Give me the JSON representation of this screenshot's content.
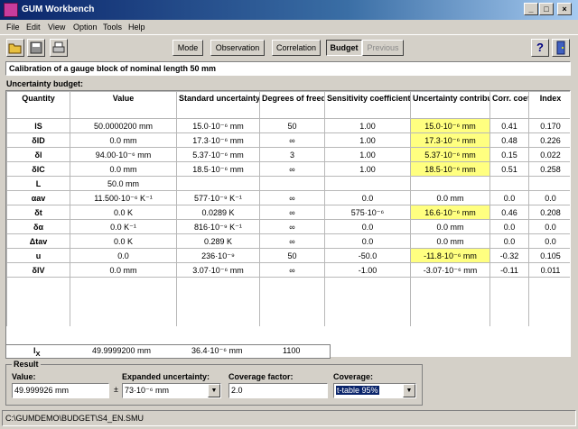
{
  "window": {
    "title": "GUM Workbench"
  },
  "menu": [
    "File",
    "Edit",
    "View",
    "Option",
    "Tools",
    "Help"
  ],
  "toolbar": {
    "mode": "Mode",
    "observation": "Observation",
    "correlation": "Correlation",
    "budget": "Budget",
    "previous": "Previous",
    "help": "?"
  },
  "calibration_title": "Calibration of a gauge block of nominal length 50 mm",
  "budget_label": "Uncertainty budget:",
  "table": {
    "headers": [
      "Quantity",
      "Value",
      "Standard uncertainty",
      "Degrees of freedom",
      "Sensitivity coefficient",
      "Uncertainty contribution",
      "Corr. coeff",
      "Index"
    ],
    "rows": [
      {
        "q": "lS",
        "value": "50.0000200 mm",
        "unc": "15.0·10⁻⁶ mm",
        "dof": "50",
        "sens": "1.00",
        "contrib": "15.0·10⁻⁶ mm",
        "corr": "0.41",
        "index": "0.170"
      },
      {
        "q": "δlD",
        "value": "0.0 mm",
        "unc": "17.3·10⁻⁶ mm",
        "dof": "∞",
        "sens": "1.00",
        "contrib": "17.3·10⁻⁶ mm",
        "corr": "0.48",
        "index": "0.226"
      },
      {
        "q": "δl",
        "value": "94.00·10⁻⁶ mm",
        "unc": "5.37·10⁻⁶ mm",
        "dof": "3",
        "sens": "1.00",
        "contrib": "5.37·10⁻⁶ mm",
        "corr": "0.15",
        "index": "0.022"
      },
      {
        "q": "δlC",
        "value": "0.0 mm",
        "unc": "18.5·10⁻⁶ mm",
        "dof": "∞",
        "sens": "1.00",
        "contrib": "18.5·10⁻⁶ mm",
        "corr": "0.51",
        "index": "0.258"
      },
      {
        "q": "L",
        "value": "50.0 mm",
        "unc": "",
        "dof": "",
        "sens": "",
        "contrib": "",
        "corr": "",
        "index": ""
      },
      {
        "q": "αav",
        "value": "11.500·10⁻⁶ K⁻¹",
        "unc": "577·10⁻⁹ K⁻¹",
        "dof": "∞",
        "sens": "0.0",
        "contrib": "0.0 mm",
        "corr": "0.0",
        "index": "0.0"
      },
      {
        "q": "δt",
        "value": "0.0 K",
        "unc": "0.0289 K",
        "dof": "∞",
        "sens": "575·10⁻⁶",
        "contrib": "16.6·10⁻⁶ mm",
        "corr": "0.46",
        "index": "0.208"
      },
      {
        "q": "δα",
        "value": "0.0 K⁻¹",
        "unc": "816·10⁻⁹ K⁻¹",
        "dof": "∞",
        "sens": "0.0",
        "contrib": "0.0 mm",
        "corr": "0.0",
        "index": "0.0"
      },
      {
        "q": "Δtav",
        "value": "0.0 K",
        "unc": "0.289 K",
        "dof": "∞",
        "sens": "0.0",
        "contrib": "0.0 mm",
        "corr": "0.0",
        "index": "0.0"
      },
      {
        "q": "u",
        "value": "0.0",
        "unc": "236·10⁻⁹",
        "dof": "50",
        "sens": "-50.0",
        "contrib": "-11.8·10⁻⁶ mm",
        "corr": "-0.32",
        "index": "0.105"
      },
      {
        "q": "δlV",
        "value": "0.0 mm",
        "unc": "3.07·10⁻⁶ mm",
        "dof": "∞",
        "sens": "-1.00",
        "contrib": "-3.07·10⁻⁶ mm",
        "corr": "-0.11",
        "index": "0.011"
      }
    ],
    "highlight_rows": [
      0,
      1,
      2,
      3,
      6,
      9
    ]
  },
  "result_row": {
    "q": "lX",
    "value": "49.9999200 mm",
    "unc": "36.4·10⁻⁶ mm",
    "dof": "1100"
  },
  "result": {
    "legend": "Result",
    "value_label": "Value:",
    "value": "49.999926 mm",
    "plusminus": "±",
    "expanded_label": "Expanded uncertainty:",
    "expanded": "73·10⁻⁶ mm",
    "factor_label": "Coverage factor:",
    "factor": "2.0",
    "coverage_label": "Coverage:",
    "coverage": "t-table 95%"
  },
  "status": "C:\\GUMDEMO\\BUDGET\\S4_EN.SMU",
  "colors": {
    "highlight": "#ffff80",
    "titlebar": "#0a246a",
    "window": "#d4d0c8"
  }
}
